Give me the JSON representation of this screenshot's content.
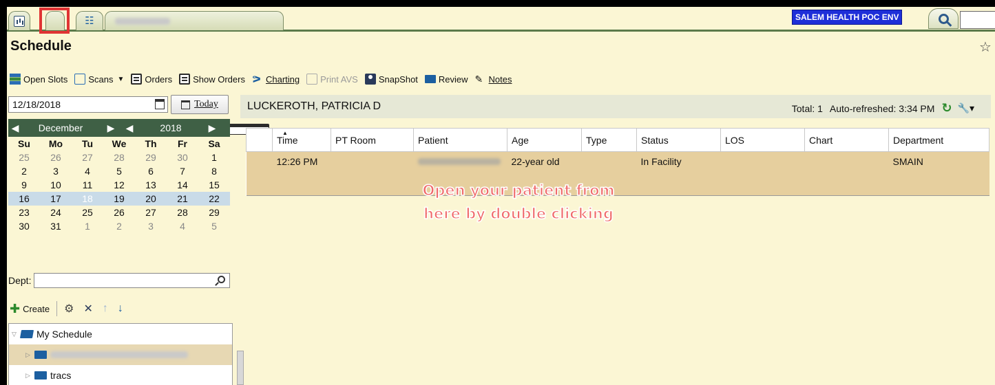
{
  "tabs": {
    "env_badge": "SALEM HEALTH POC ENV"
  },
  "header": {
    "title": "Schedule"
  },
  "toolbar": {
    "open_slots": "Open Slots",
    "scans": "Scans",
    "orders": "Orders",
    "show_orders": "Show Orders",
    "charting": "Charting",
    "print_avs": "Print AVS",
    "snapshot": "SnapShot",
    "review": "Review",
    "notes": "Notes"
  },
  "date_field": {
    "value": "12/18/2018"
  },
  "today_button": "Today",
  "calendar": {
    "month": "December",
    "year": "2018",
    "weekdays": [
      "Su",
      "Mo",
      "Tu",
      "We",
      "Th",
      "Fr",
      "Sa"
    ],
    "weeks": [
      [
        "25",
        "26",
        "27",
        "28",
        "29",
        "30",
        "1"
      ],
      [
        "2",
        "3",
        "4",
        "5",
        "6",
        "7",
        "8"
      ],
      [
        "9",
        "10",
        "11",
        "12",
        "13",
        "14",
        "15"
      ],
      [
        "16",
        "17",
        "18",
        "19",
        "20",
        "21",
        "22"
      ],
      [
        "23",
        "24",
        "25",
        "26",
        "27",
        "28",
        "29"
      ],
      [
        "30",
        "31",
        "1",
        "2",
        "3",
        "4",
        "5"
      ]
    ],
    "selected": "18"
  },
  "dept": {
    "label": "Dept:"
  },
  "tree_toolbar": {
    "create": "Create"
  },
  "tree": {
    "root": "My Schedule",
    "items": [
      "tracs"
    ]
  },
  "patient_bar": {
    "name": "LUCKEROTH, PATRICIA D",
    "total": "Total: 1",
    "refreshed": "Auto-refreshed: 3:34 PM"
  },
  "grid": {
    "columns": [
      "Time",
      "PT Room",
      "Patient",
      "Age",
      "Type",
      "Status",
      "LOS",
      "Chart",
      "Department"
    ],
    "rows": [
      {
        "time": "12:26 PM",
        "pt_room": "",
        "age": "22-year old",
        "type": "",
        "status": "In Facility",
        "los": "",
        "chart": "",
        "department": "SMAIN"
      }
    ]
  },
  "callout": {
    "line1": "Open your patient from",
    "line2": "here by double clicking"
  },
  "colors": {
    "highlight": "#e03434",
    "calendar_header": "#3f6045",
    "selected_row": "#e6cf9e",
    "env_badge": "#1e2fd8",
    "callout_text": "#f06a6a"
  }
}
